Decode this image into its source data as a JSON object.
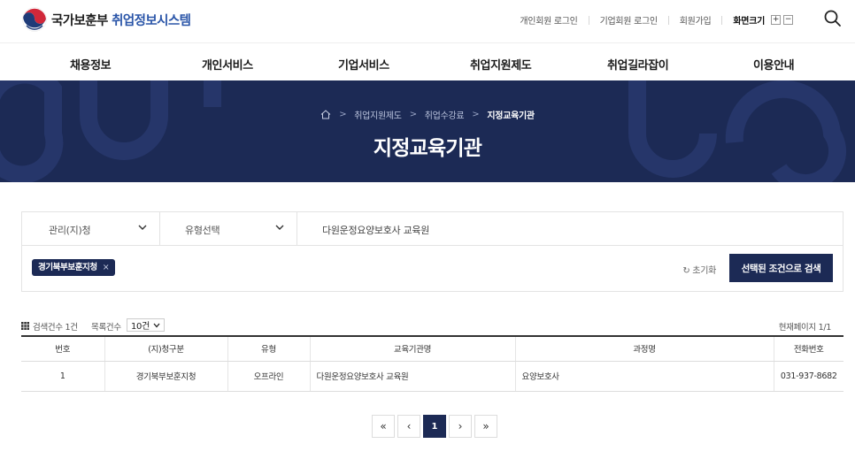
{
  "header": {
    "logo_org": "국가보훈부",
    "logo_service": "취업정보시스템",
    "utils": {
      "personal_login": "개인회원 로그인",
      "company_login": "기업회원 로그인",
      "signup": "회원가입",
      "font_size_label": "화면크기",
      "font_plus": "+",
      "font_minus": "−"
    }
  },
  "gnb": [
    "채용정보",
    "개인서비스",
    "기업서비스",
    "취업지원제도",
    "취업길라잡이",
    "이용안내"
  ],
  "banner": {
    "breadcrumb": [
      "취업지원제도",
      "취업수강료"
    ],
    "breadcrumb_current": "지정교육기관",
    "title": "지정교육기관"
  },
  "search": {
    "office_select": "관리(지)청",
    "type_select": "유형선택",
    "keyword": "다원운정요양보호사 교육원",
    "chip_label": "경기북부보훈지청",
    "chip_remove": "×",
    "reset_label": "초기화",
    "reset_icon": "↻",
    "submit_label": "선택된 조건으로 검색"
  },
  "result_meta": {
    "count_label": "검색건수 1건",
    "perpage_label": "목록건수",
    "perpage_value": "10건",
    "page_info": "현재페이지 1/1"
  },
  "table": {
    "headers": [
      "번호",
      "(지)청구분",
      "유형",
      "교육기관명",
      "과정명",
      "전화번호"
    ],
    "rows": [
      [
        "1",
        "경기북부보훈지청",
        "오프라인",
        "다원운정요양보호사 교육원",
        "요양보호사",
        "031-937-8682"
      ]
    ]
  },
  "pagination": {
    "first": "«",
    "prev": "‹",
    "current": "1",
    "next": "›",
    "last": "»"
  },
  "colors": {
    "navy": "#1c2a55",
    "accent_blue": "#2a55a8"
  }
}
